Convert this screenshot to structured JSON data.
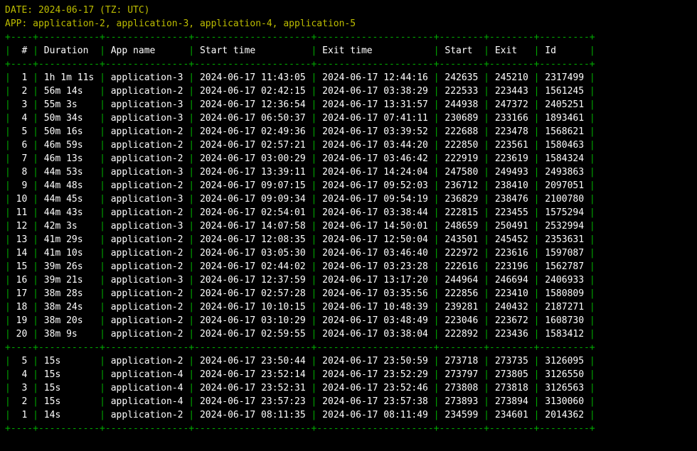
{
  "header": {
    "date_label": "DATE:",
    "date_value": "2024-06-17 (TZ: UTC)",
    "app_label": "APP:",
    "app_value": "application-2, application-3, application-4, application-5"
  },
  "layout": {
    "widths": {
      "num": 2,
      "dur": 9,
      "app": 13,
      "start": 19,
      "exit": 19,
      "sc": 6,
      "ec": 6,
      "id": 7
    },
    "dash_spec": [
      4,
      11,
      15,
      21,
      21,
      8,
      8,
      9
    ]
  },
  "columns": [
    "#",
    "Duration",
    "App name",
    "Start time",
    "Exit time",
    "Start",
    "Exit",
    "Id"
  ],
  "rows_top": [
    {
      "n": "1",
      "dur": "1h 1m 11s",
      "app": "application-3",
      "st": "2024-06-17 11:43:05",
      "et": "2024-06-17 12:44:16",
      "sc": "242635",
      "ec": "245210",
      "id": "2317499"
    },
    {
      "n": "2",
      "dur": "56m 14s",
      "app": "application-2",
      "st": "2024-06-17 02:42:15",
      "et": "2024-06-17 03:38:29",
      "sc": "222533",
      "ec": "223443",
      "id": "1561245"
    },
    {
      "n": "3",
      "dur": "55m 3s",
      "app": "application-3",
      "st": "2024-06-17 12:36:54",
      "et": "2024-06-17 13:31:57",
      "sc": "244938",
      "ec": "247372",
      "id": "2405251"
    },
    {
      "n": "4",
      "dur": "50m 34s",
      "app": "application-3",
      "st": "2024-06-17 06:50:37",
      "et": "2024-06-17 07:41:11",
      "sc": "230689",
      "ec": "233166",
      "id": "1893461"
    },
    {
      "n": "5",
      "dur": "50m 16s",
      "app": "application-2",
      "st": "2024-06-17 02:49:36",
      "et": "2024-06-17 03:39:52",
      "sc": "222688",
      "ec": "223478",
      "id": "1568621"
    },
    {
      "n": "6",
      "dur": "46m 59s",
      "app": "application-2",
      "st": "2024-06-17 02:57:21",
      "et": "2024-06-17 03:44:20",
      "sc": "222850",
      "ec": "223561",
      "id": "1580463"
    },
    {
      "n": "7",
      "dur": "46m 13s",
      "app": "application-2",
      "st": "2024-06-17 03:00:29",
      "et": "2024-06-17 03:46:42",
      "sc": "222919",
      "ec": "223619",
      "id": "1584324"
    },
    {
      "n": "8",
      "dur": "44m 53s",
      "app": "application-3",
      "st": "2024-06-17 13:39:11",
      "et": "2024-06-17 14:24:04",
      "sc": "247580",
      "ec": "249493",
      "id": "2493863"
    },
    {
      "n": "9",
      "dur": "44m 48s",
      "app": "application-2",
      "st": "2024-06-17 09:07:15",
      "et": "2024-06-17 09:52:03",
      "sc": "236712",
      "ec": "238410",
      "id": "2097051"
    },
    {
      "n": "10",
      "dur": "44m 45s",
      "app": "application-3",
      "st": "2024-06-17 09:09:34",
      "et": "2024-06-17 09:54:19",
      "sc": "236829",
      "ec": "238476",
      "id": "2100780"
    },
    {
      "n": "11",
      "dur": "44m 43s",
      "app": "application-2",
      "st": "2024-06-17 02:54:01",
      "et": "2024-06-17 03:38:44",
      "sc": "222815",
      "ec": "223455",
      "id": "1575294"
    },
    {
      "n": "12",
      "dur": "42m 3s",
      "app": "application-3",
      "st": "2024-06-17 14:07:58",
      "et": "2024-06-17 14:50:01",
      "sc": "248659",
      "ec": "250491",
      "id": "2532994"
    },
    {
      "n": "13",
      "dur": "41m 29s",
      "app": "application-2",
      "st": "2024-06-17 12:08:35",
      "et": "2024-06-17 12:50:04",
      "sc": "243501",
      "ec": "245452",
      "id": "2353631"
    },
    {
      "n": "14",
      "dur": "41m 10s",
      "app": "application-2",
      "st": "2024-06-17 03:05:30",
      "et": "2024-06-17 03:46:40",
      "sc": "222972",
      "ec": "223616",
      "id": "1597087"
    },
    {
      "n": "15",
      "dur": "39m 26s",
      "app": "application-2",
      "st": "2024-06-17 02:44:02",
      "et": "2024-06-17 03:23:28",
      "sc": "222616",
      "ec": "223196",
      "id": "1562787"
    },
    {
      "n": "16",
      "dur": "39m 21s",
      "app": "application-3",
      "st": "2024-06-17 12:37:59",
      "et": "2024-06-17 13:17:20",
      "sc": "244964",
      "ec": "246694",
      "id": "2406933"
    },
    {
      "n": "17",
      "dur": "38m 28s",
      "app": "application-2",
      "st": "2024-06-17 02:57:28",
      "et": "2024-06-17 03:35:56",
      "sc": "222856",
      "ec": "223410",
      "id": "1580809"
    },
    {
      "n": "18",
      "dur": "38m 24s",
      "app": "application-2",
      "st": "2024-06-17 10:10:15",
      "et": "2024-06-17 10:48:39",
      "sc": "239281",
      "ec": "240432",
      "id": "2187271"
    },
    {
      "n": "19",
      "dur": "38m 20s",
      "app": "application-2",
      "st": "2024-06-17 03:10:29",
      "et": "2024-06-17 03:48:49",
      "sc": "223046",
      "ec": "223672",
      "id": "1608730"
    },
    {
      "n": "20",
      "dur": "38m 9s",
      "app": "application-2",
      "st": "2024-06-17 02:59:55",
      "et": "2024-06-17 03:38:04",
      "sc": "222892",
      "ec": "223436",
      "id": "1583412"
    }
  ],
  "rows_bottom": [
    {
      "n": "5",
      "dur": "15s",
      "app": "application-2",
      "st": "2024-06-17 23:50:44",
      "et": "2024-06-17 23:50:59",
      "sc": "273718",
      "ec": "273735",
      "id": "3126095"
    },
    {
      "n": "4",
      "dur": "15s",
      "app": "application-4",
      "st": "2024-06-17 23:52:14",
      "et": "2024-06-17 23:52:29",
      "sc": "273797",
      "ec": "273805",
      "id": "3126550"
    },
    {
      "n": "3",
      "dur": "15s",
      "app": "application-4",
      "st": "2024-06-17 23:52:31",
      "et": "2024-06-17 23:52:46",
      "sc": "273808",
      "ec": "273818",
      "id": "3126563"
    },
    {
      "n": "2",
      "dur": "15s",
      "app": "application-4",
      "st": "2024-06-17 23:57:23",
      "et": "2024-06-17 23:57:38",
      "sc": "273893",
      "ec": "273894",
      "id": "3130060"
    },
    {
      "n": "1",
      "dur": "14s",
      "app": "application-2",
      "st": "2024-06-17 08:11:35",
      "et": "2024-06-17 08:11:49",
      "sc": "234599",
      "ec": "234601",
      "id": "2014362"
    }
  ]
}
